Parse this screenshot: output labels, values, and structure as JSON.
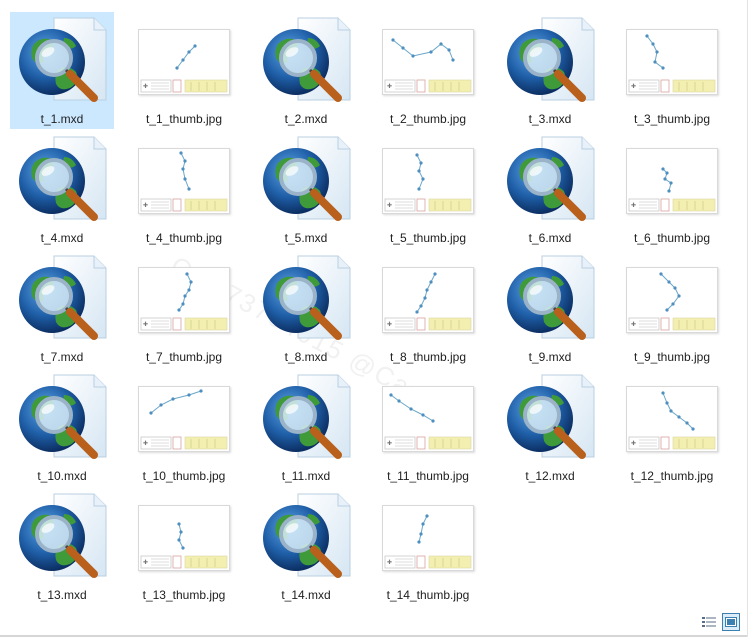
{
  "files": [
    {
      "name": "t_1.mxd",
      "type": "mxd",
      "selected": true
    },
    {
      "name": "t_1_thumb.jpg",
      "type": "jpg",
      "variant": 0
    },
    {
      "name": "t_2.mxd",
      "type": "mxd"
    },
    {
      "name": "t_2_thumb.jpg",
      "type": "jpg",
      "variant": 1
    },
    {
      "name": "t_3.mxd",
      "type": "mxd"
    },
    {
      "name": "t_3_thumb.jpg",
      "type": "jpg",
      "variant": 2
    },
    {
      "name": "t_4.mxd",
      "type": "mxd"
    },
    {
      "name": "t_4_thumb.jpg",
      "type": "jpg",
      "variant": 3
    },
    {
      "name": "t_5.mxd",
      "type": "mxd"
    },
    {
      "name": "t_5_thumb.jpg",
      "type": "jpg",
      "variant": 4
    },
    {
      "name": "t_6.mxd",
      "type": "mxd"
    },
    {
      "name": "t_6_thumb.jpg",
      "type": "jpg",
      "variant": 5
    },
    {
      "name": "t_7.mxd",
      "type": "mxd"
    },
    {
      "name": "t_7_thumb.jpg",
      "type": "jpg",
      "variant": 6
    },
    {
      "name": "t_8.mxd",
      "type": "mxd"
    },
    {
      "name": "t_8_thumb.jpg",
      "type": "jpg",
      "variant": 7
    },
    {
      "name": "t_9.mxd",
      "type": "mxd"
    },
    {
      "name": "t_9_thumb.jpg",
      "type": "jpg",
      "variant": 8
    },
    {
      "name": "t_10.mxd",
      "type": "mxd"
    },
    {
      "name": "t_10_thumb.jpg",
      "type": "jpg",
      "variant": 9
    },
    {
      "name": "t_11.mxd",
      "type": "mxd"
    },
    {
      "name": "t_11_thumb.jpg",
      "type": "jpg",
      "variant": 10
    },
    {
      "name": "t_12.mxd",
      "type": "mxd"
    },
    {
      "name": "t_12_thumb.jpg",
      "type": "jpg",
      "variant": 11
    },
    {
      "name": "t_13.mxd",
      "type": "mxd"
    },
    {
      "name": "t_13_thumb.jpg",
      "type": "jpg",
      "variant": 12
    },
    {
      "name": "t_14.mxd",
      "type": "mxd"
    },
    {
      "name": "t_14_thumb.jpg",
      "type": "jpg",
      "variant": 13
    }
  ],
  "icons": {
    "mxd": "globe-magnifier-document-icon",
    "jpg": "map-thumbnail-icon"
  },
  "colors": {
    "selection": "#cce8ff",
    "globe_ocean": "#1f5fa8",
    "globe_land": "#3f9a3a",
    "lens": "#d8ecf7",
    "handle": "#b8601c",
    "track_line": "#6aa7c9",
    "legend_yellow": "#f3efb0"
  },
  "watermark": "QQ373704015 @Capsion",
  "view": {
    "details_label": "details-view",
    "large_icons_label": "large-icons-view",
    "active": "large-icons"
  }
}
